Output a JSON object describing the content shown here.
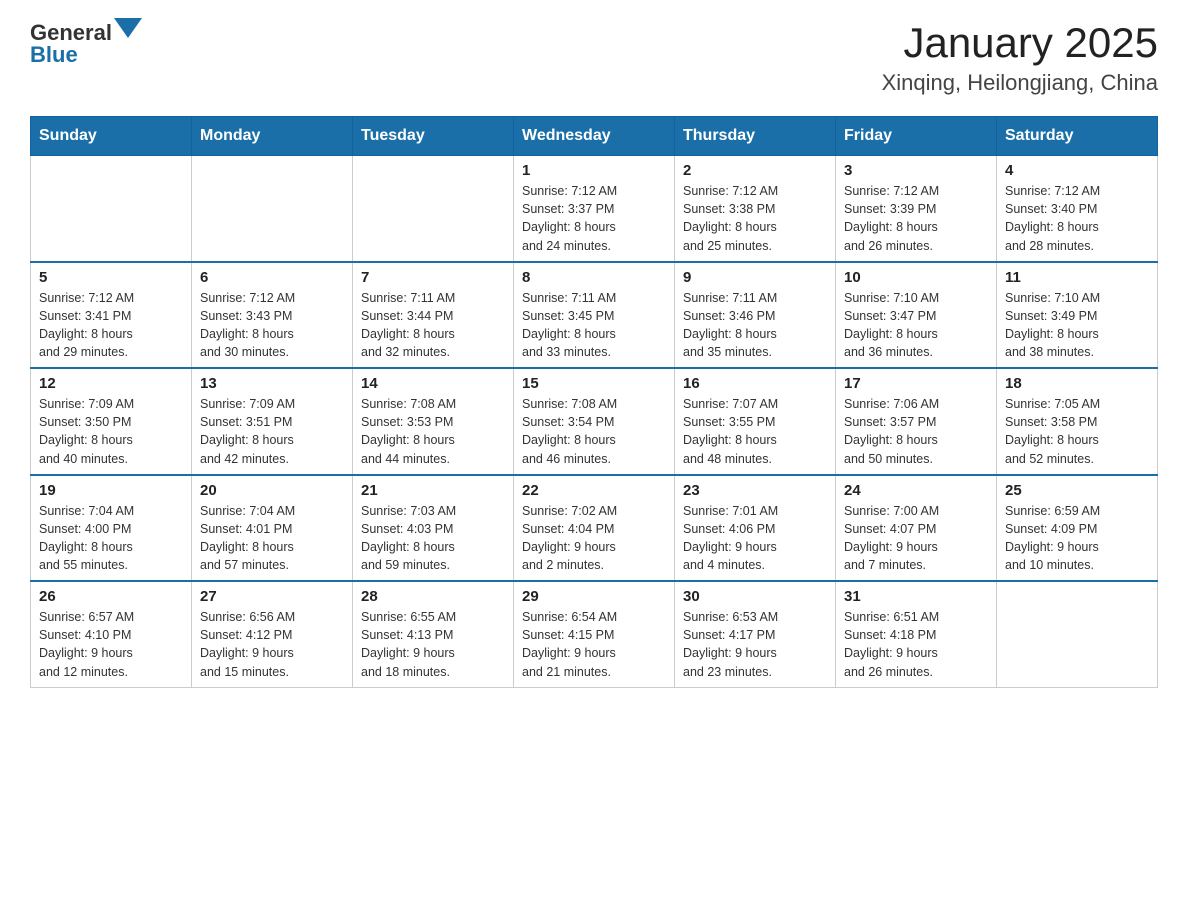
{
  "header": {
    "logo_general": "General",
    "logo_blue": "Blue",
    "month_year": "January 2025",
    "location": "Xinqing, Heilongjiang, China"
  },
  "weekdays": [
    "Sunday",
    "Monday",
    "Tuesday",
    "Wednesday",
    "Thursday",
    "Friday",
    "Saturday"
  ],
  "weeks": [
    [
      {
        "day": "",
        "info": ""
      },
      {
        "day": "",
        "info": ""
      },
      {
        "day": "",
        "info": ""
      },
      {
        "day": "1",
        "info": "Sunrise: 7:12 AM\nSunset: 3:37 PM\nDaylight: 8 hours\nand 24 minutes."
      },
      {
        "day": "2",
        "info": "Sunrise: 7:12 AM\nSunset: 3:38 PM\nDaylight: 8 hours\nand 25 minutes."
      },
      {
        "day": "3",
        "info": "Sunrise: 7:12 AM\nSunset: 3:39 PM\nDaylight: 8 hours\nand 26 minutes."
      },
      {
        "day": "4",
        "info": "Sunrise: 7:12 AM\nSunset: 3:40 PM\nDaylight: 8 hours\nand 28 minutes."
      }
    ],
    [
      {
        "day": "5",
        "info": "Sunrise: 7:12 AM\nSunset: 3:41 PM\nDaylight: 8 hours\nand 29 minutes."
      },
      {
        "day": "6",
        "info": "Sunrise: 7:12 AM\nSunset: 3:43 PM\nDaylight: 8 hours\nand 30 minutes."
      },
      {
        "day": "7",
        "info": "Sunrise: 7:11 AM\nSunset: 3:44 PM\nDaylight: 8 hours\nand 32 minutes."
      },
      {
        "day": "8",
        "info": "Sunrise: 7:11 AM\nSunset: 3:45 PM\nDaylight: 8 hours\nand 33 minutes."
      },
      {
        "day": "9",
        "info": "Sunrise: 7:11 AM\nSunset: 3:46 PM\nDaylight: 8 hours\nand 35 minutes."
      },
      {
        "day": "10",
        "info": "Sunrise: 7:10 AM\nSunset: 3:47 PM\nDaylight: 8 hours\nand 36 minutes."
      },
      {
        "day": "11",
        "info": "Sunrise: 7:10 AM\nSunset: 3:49 PM\nDaylight: 8 hours\nand 38 minutes."
      }
    ],
    [
      {
        "day": "12",
        "info": "Sunrise: 7:09 AM\nSunset: 3:50 PM\nDaylight: 8 hours\nand 40 minutes."
      },
      {
        "day": "13",
        "info": "Sunrise: 7:09 AM\nSunset: 3:51 PM\nDaylight: 8 hours\nand 42 minutes."
      },
      {
        "day": "14",
        "info": "Sunrise: 7:08 AM\nSunset: 3:53 PM\nDaylight: 8 hours\nand 44 minutes."
      },
      {
        "day": "15",
        "info": "Sunrise: 7:08 AM\nSunset: 3:54 PM\nDaylight: 8 hours\nand 46 minutes."
      },
      {
        "day": "16",
        "info": "Sunrise: 7:07 AM\nSunset: 3:55 PM\nDaylight: 8 hours\nand 48 minutes."
      },
      {
        "day": "17",
        "info": "Sunrise: 7:06 AM\nSunset: 3:57 PM\nDaylight: 8 hours\nand 50 minutes."
      },
      {
        "day": "18",
        "info": "Sunrise: 7:05 AM\nSunset: 3:58 PM\nDaylight: 8 hours\nand 52 minutes."
      }
    ],
    [
      {
        "day": "19",
        "info": "Sunrise: 7:04 AM\nSunset: 4:00 PM\nDaylight: 8 hours\nand 55 minutes."
      },
      {
        "day": "20",
        "info": "Sunrise: 7:04 AM\nSunset: 4:01 PM\nDaylight: 8 hours\nand 57 minutes."
      },
      {
        "day": "21",
        "info": "Sunrise: 7:03 AM\nSunset: 4:03 PM\nDaylight: 8 hours\nand 59 minutes."
      },
      {
        "day": "22",
        "info": "Sunrise: 7:02 AM\nSunset: 4:04 PM\nDaylight: 9 hours\nand 2 minutes."
      },
      {
        "day": "23",
        "info": "Sunrise: 7:01 AM\nSunset: 4:06 PM\nDaylight: 9 hours\nand 4 minutes."
      },
      {
        "day": "24",
        "info": "Sunrise: 7:00 AM\nSunset: 4:07 PM\nDaylight: 9 hours\nand 7 minutes."
      },
      {
        "day": "25",
        "info": "Sunrise: 6:59 AM\nSunset: 4:09 PM\nDaylight: 9 hours\nand 10 minutes."
      }
    ],
    [
      {
        "day": "26",
        "info": "Sunrise: 6:57 AM\nSunset: 4:10 PM\nDaylight: 9 hours\nand 12 minutes."
      },
      {
        "day": "27",
        "info": "Sunrise: 6:56 AM\nSunset: 4:12 PM\nDaylight: 9 hours\nand 15 minutes."
      },
      {
        "day": "28",
        "info": "Sunrise: 6:55 AM\nSunset: 4:13 PM\nDaylight: 9 hours\nand 18 minutes."
      },
      {
        "day": "29",
        "info": "Sunrise: 6:54 AM\nSunset: 4:15 PM\nDaylight: 9 hours\nand 21 minutes."
      },
      {
        "day": "30",
        "info": "Sunrise: 6:53 AM\nSunset: 4:17 PM\nDaylight: 9 hours\nand 23 minutes."
      },
      {
        "day": "31",
        "info": "Sunrise: 6:51 AM\nSunset: 4:18 PM\nDaylight: 9 hours\nand 26 minutes."
      },
      {
        "day": "",
        "info": ""
      }
    ]
  ]
}
